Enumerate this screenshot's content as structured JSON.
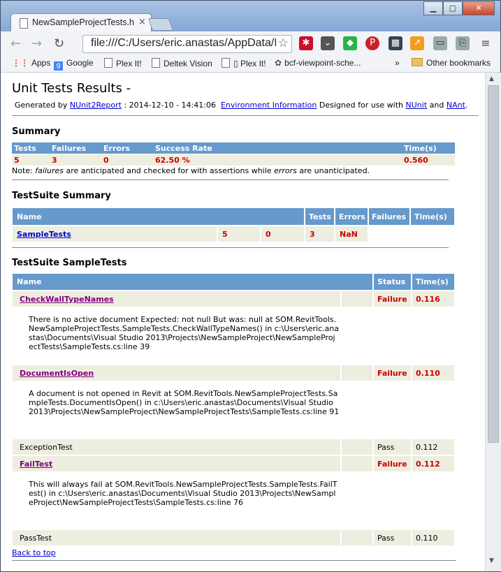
{
  "browser": {
    "tab_title": "NewSampleProjectTests.h",
    "tab_close": "×",
    "url": "file:///C:/Users/eric.anastas/AppData/R",
    "bookmarks": [
      "Apps",
      "Google",
      "Plex It!",
      "Deltek Vision",
      "▯ Plex It!",
      "bcf-viewpoint-sche..."
    ],
    "more": "»",
    "other_bookmarks": "Other bookmarks"
  },
  "report": {
    "title": "Unit Tests Results -",
    "generated_prefix": "Generated by",
    "generator": "NUnit2Report",
    "timestamp": ": 2014-12-10 - 14:41:06",
    "env_link": "Environment Information",
    "designed_for": "Designed for use with",
    "nunit": "NUnit",
    "and": "and",
    "nant": "NAnt",
    "period": "."
  },
  "summary": {
    "heading": "Summary",
    "headers": [
      "Tests",
      "Failures",
      "Errors",
      "Success Rate",
      "Time(s)"
    ],
    "values": [
      "5",
      "3",
      "0",
      "62.50 %",
      "0.560"
    ],
    "note_prefix": "Note: ",
    "note_failures": "failures",
    "note_middle": " are anticipated and checked for with assertions while ",
    "note_errors": "errors",
    "note_suffix": " are unanticipated."
  },
  "suite_summary": {
    "heading": "TestSuite Summary",
    "headers": [
      "Name",
      "Tests",
      "Errors",
      "Failures",
      "Time(s)"
    ],
    "row": [
      "SampleTests",
      "5",
      "0",
      "3",
      "NaN"
    ]
  },
  "suite": {
    "heading": "TestSuite SampleTests",
    "headers": [
      "Name",
      "Status",
      "Time(s)"
    ],
    "tests": [
      {
        "name": "CheckWallTypeNames",
        "status": "Failure",
        "time": "0.116",
        "detail": "There is no active document Expected: not null But was: null at SOM.RevitTools.NewSampleProjectTests.SampleTests.CheckWallTypeNames() in c:\\Users\\eric.anastas\\Documents\\Visual Studio 2013\\Projects\\NewSampleProject\\NewSampleProjectTests\\SampleTests.cs:line 39"
      },
      {
        "name": "DocumentIsOpen",
        "status": "Failure",
        "time": "0.110",
        "detail": "A document is not opened in Revit at SOM.RevitTools.NewSampleProjectTests.SampleTests.DocumentIsOpen() in c:\\Users\\eric.anastas\\Documents\\Visual Studio 2013\\Projects\\NewSampleProject\\NewSampleProjectTests\\SampleTests.cs:line 91"
      },
      {
        "name": "ExceptionTest",
        "status": "Pass",
        "time": "0.112",
        "detail": ""
      },
      {
        "name": "FailTest",
        "status": "Failure",
        "time": "0.112",
        "detail": "This will always fail at SOM.RevitTools.NewSampleProjectTests.SampleTests.FailTest() in c:\\Users\\eric.anastas\\Documents\\Visual Studio 2013\\Projects\\NewSampleProject\\NewSampleProjectTests\\SampleTests.cs:line 76"
      },
      {
        "name": "PassTest",
        "status": "Pass",
        "time": "0.110",
        "detail": ""
      }
    ],
    "back_to_top": "Back to top"
  }
}
